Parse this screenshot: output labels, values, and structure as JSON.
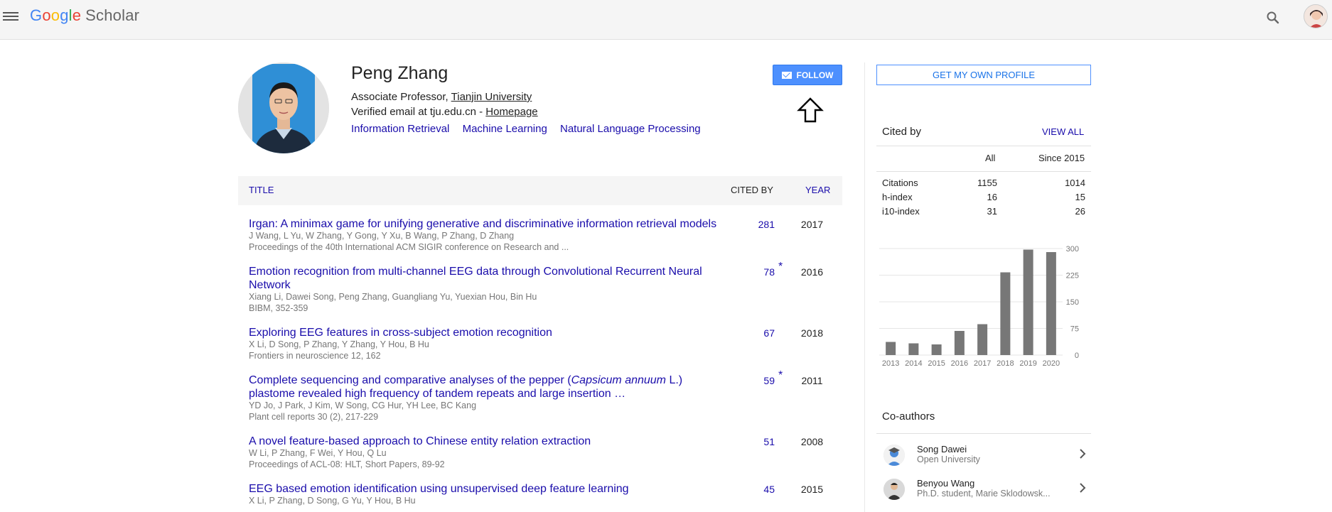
{
  "header": {
    "logo_letters": [
      "G",
      "o",
      "o",
      "g",
      "l",
      "e"
    ],
    "logo_product": "Scholar",
    "icons": [
      "menu-icon",
      "search-icon",
      "user-avatar"
    ]
  },
  "profile": {
    "name": "Peng Zhang",
    "position_prefix": "Associate Professor, ",
    "institution": "Tianjin University",
    "email_text": "Verified email at tju.edu.cn - ",
    "homepage_label": "Homepage",
    "interests": [
      "Information Retrieval",
      "Machine Learning",
      "Natural Language Processing"
    ],
    "follow_label": "FOLLOW"
  },
  "table": {
    "headers": {
      "title": "TITLE",
      "cited_by": "CITED BY",
      "year": "YEAR"
    },
    "rows": [
      {
        "title": "Irgan: A minimax game for unifying generative and discriminative information retrieval models",
        "authors": "J Wang, L Yu, W Zhang, Y Gong, Y Xu, B Wang, P Zhang, D Zhang",
        "venue": "Proceedings of the 40th International ACM SIGIR conference on Research and ...",
        "cited": "281",
        "star": "",
        "year": "2017"
      },
      {
        "title": "Emotion recognition from multi-channel EEG data through Convolutional Recurrent Neural Network",
        "authors": "Xiang Li, Dawei Song, Peng Zhang, Guangliang Yu, Yuexian Hou, Bin Hu",
        "venue": "BIBM, 352-359",
        "cited": "78",
        "star": "*",
        "year": "2016"
      },
      {
        "title": "Exploring EEG features in cross-subject emotion recognition",
        "authors": "X Li, D Song, P Zhang, Y Zhang, Y Hou, B Hu",
        "venue": "Frontiers in neuroscience 12, 162",
        "cited": "67",
        "star": "",
        "year": "2018"
      },
      {
        "title_parts": [
          "Complete sequencing and comparative analyses of the pepper (",
          "Capsicum annuum",
          " L.) plastome revealed high frequency of tandem repeats and large insertion …"
        ],
        "authors": "YD Jo, J Park, J Kim, W Song, CG Hur, YH Lee, BC Kang",
        "venue": "Plant cell reports 30 (2), 217-229",
        "cited": "59",
        "star": "*",
        "year": "2011"
      },
      {
        "title": "A novel feature-based approach to Chinese entity relation extraction",
        "authors": "W Li, P Zhang, F Wei, Y Hou, Q Lu",
        "venue": "Proceedings of ACL-08: HLT, Short Papers, 89-92",
        "cited": "51",
        "star": "",
        "year": "2008"
      },
      {
        "title": "EEG based emotion identification using unsupervised deep feature learning",
        "authors": "X Li, P Zhang, D Song, G Yu, Y Hou, B Hu",
        "venue": "",
        "cited": "45",
        "star": "",
        "year": "2015"
      }
    ]
  },
  "sidebar": {
    "get_profile_label": "GET MY OWN PROFILE",
    "cited_by_label": "Cited by",
    "view_all_label": "VIEW ALL",
    "stats": {
      "col_all": "All",
      "col_since": "Since 2015",
      "rows": [
        {
          "label": "Citations",
          "all": "1155",
          "since": "1014"
        },
        {
          "label": "h-index",
          "all": "16",
          "since": "15"
        },
        {
          "label": "i10-index",
          "all": "31",
          "since": "26"
        }
      ]
    },
    "coauthors_label": "Co-authors",
    "coauthors": [
      {
        "name": "Song Dawei",
        "affiliation": "Open University"
      },
      {
        "name": "Benyou Wang",
        "affiliation": "Ph.D. student, Marie Sklodowsk..."
      }
    ]
  },
  "chart_data": {
    "type": "bar",
    "categories": [
      "2013",
      "2014",
      "2015",
      "2016",
      "2017",
      "2018",
      "2019",
      "2020"
    ],
    "values": [
      37,
      33,
      30,
      68,
      87,
      233,
      297,
      290
    ],
    "y_ticks": [
      "0",
      "75",
      "150",
      "225",
      "300"
    ],
    "ylim": [
      0,
      300
    ],
    "bar_color": "#777777",
    "grid": true,
    "y_axis_side": "right"
  }
}
